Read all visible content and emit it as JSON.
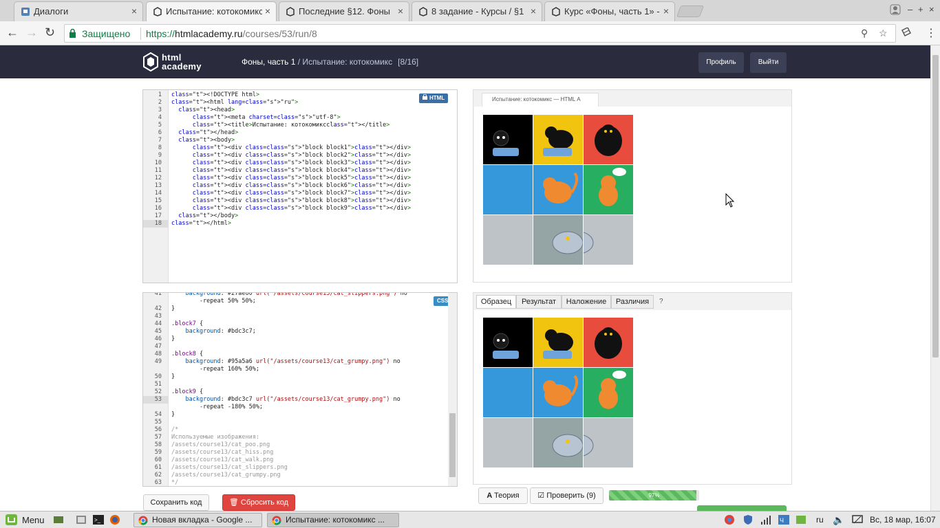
{
  "browser": {
    "tabs": [
      {
        "label": "Диалоги",
        "icon": "chat-icon"
      },
      {
        "label": "Испытание: котокомикс",
        "icon": "htmlacademy-icon"
      },
      {
        "label": "Последние §12. Фоны",
        "icon": "htmlacademy-icon"
      },
      {
        "label": "8 задание - Курсы / §1",
        "icon": "htmlacademy-icon"
      },
      {
        "label": "Курс «Фоны, часть 1» -",
        "icon": "htmlacademy-icon"
      }
    ],
    "secure_label": "Защищено",
    "url_scheme": "https://",
    "url_host": "htmlacademy.ru",
    "url_path": "/courses/53/run/8"
  },
  "header": {
    "logo_line1": "html",
    "logo_line2": "academy",
    "course": "Фоны, часть 1",
    "separator": " / ",
    "task": "Испытание: котокомикс",
    "counter": "[8/16]",
    "profile_button": "Профиль",
    "logout_button": "Выйти"
  },
  "html_editor": {
    "badge": "HTML",
    "lines": [
      {
        "n": "1",
        "code": "<!DOCTYPE html>"
      },
      {
        "n": "2",
        "code": "<html lang=\"ru\">"
      },
      {
        "n": "3",
        "code": "  <head>"
      },
      {
        "n": "4",
        "code": "      <meta charset=\"utf-8\">"
      },
      {
        "n": "5",
        "code": "      <title>Испытание: котокомикс</title>"
      },
      {
        "n": "6",
        "code": "  </head>"
      },
      {
        "n": "7",
        "code": "  <body>"
      },
      {
        "n": "8",
        "code": "      <div class=\"block block1\"></div>"
      },
      {
        "n": "9",
        "code": "      <div class=\"block block2\"></div>"
      },
      {
        "n": "10",
        "code": "      <div class=\"block block3\"></div>"
      },
      {
        "n": "11",
        "code": "      <div class=\"block block4\"></div>"
      },
      {
        "n": "12",
        "code": "      <div class=\"block block5\"></div>"
      },
      {
        "n": "13",
        "code": "      <div class=\"block block6\"></div>"
      },
      {
        "n": "14",
        "code": "      <div class=\"block block7\"></div>"
      },
      {
        "n": "15",
        "code": "      <div class=\"block block8\"></div>"
      },
      {
        "n": "16",
        "code": "      <div class=\"block block9\"></div>"
      },
      {
        "n": "17",
        "code": "  </body>"
      },
      {
        "n": "18",
        "code": "</html>"
      }
    ]
  },
  "css_editor": {
    "badge": "CSS",
    "lines": [
      {
        "n": "41",
        "code": "    background: #27ae60 url(\"/assets/course13/cat_slippers.png\") no"
      },
      {
        "n": "",
        "code": "        -repeat 50% 50%;"
      },
      {
        "n": "42",
        "code": "}"
      },
      {
        "n": "43",
        "code": ""
      },
      {
        "n": "44",
        "code": ".block7 {"
      },
      {
        "n": "45",
        "code": "    background: #bdc3c7;"
      },
      {
        "n": "46",
        "code": "}"
      },
      {
        "n": "47",
        "code": ""
      },
      {
        "n": "48",
        "code": ".block8 {"
      },
      {
        "n": "49",
        "code": "    background: #95a5a6 url(\"/assets/course13/cat_grumpy.png\") no"
      },
      {
        "n": "",
        "code": "        -repeat 160% 50%;"
      },
      {
        "n": "50",
        "code": "}"
      },
      {
        "n": "51",
        "code": ""
      },
      {
        "n": "52",
        "code": ".block9 {"
      },
      {
        "n": "53",
        "code": "    background: #bdc3c7 url(\"/assets/course13/cat_grumpy.png\") no"
      },
      {
        "n": "",
        "code": "        -repeat -180% 50%;"
      },
      {
        "n": "54",
        "code": "}"
      },
      {
        "n": "55",
        "code": ""
      },
      {
        "n": "56",
        "code": "/*"
      },
      {
        "n": "57",
        "code": "Используемые изображения:"
      },
      {
        "n": "58",
        "code": "/assets/course13/cat_poo.png"
      },
      {
        "n": "59",
        "code": "/assets/course13/cat_hiss.png"
      },
      {
        "n": "60",
        "code": "/assets/course13/cat_walk.png"
      },
      {
        "n": "61",
        "code": "/assets/course13/cat_slippers.png"
      },
      {
        "n": "62",
        "code": "/assets/course13/cat_grumpy.png"
      },
      {
        "n": "63",
        "code": "*/"
      }
    ]
  },
  "preview": {
    "tab_title": "Испытание: котокомикс — HTML А",
    "cells": [
      "#000000",
      "#f1c40f",
      "#e74c3c",
      "#3498db",
      "#3498db",
      "#27ae60",
      "#bdc3c7",
      "#95a5a6",
      "#bdc3c7"
    ]
  },
  "compare": {
    "tabs": [
      "Образец",
      "Результат",
      "Наложение",
      "Различия"
    ],
    "help": "?"
  },
  "actions": {
    "save": "Сохранить код",
    "reset": "Сбросить код",
    "theory": "Теория",
    "check": "Проверить (9)",
    "progress_label": "97%",
    "progress": 0.97
  },
  "taskbar": {
    "menu": "Menu",
    "windows": [
      "Новая вкладка - Google ...",
      "Испытание: котокомикс ..."
    ],
    "lang": "ru",
    "clock": "Вс, 18 мар, 16:07"
  }
}
